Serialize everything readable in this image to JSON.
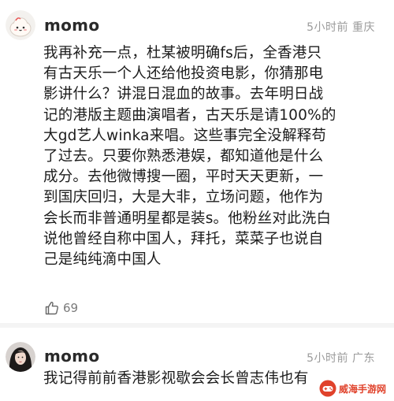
{
  "comments": [
    {
      "username": "momo",
      "meta": "5小时前 重庆",
      "text": "我再补充一点，杜某被明确fs后，全香港只\n有古天乐一个人还给他投资电影，你猜那电\n影讲什么？讲混日混血的故事。去年明日战\n记的港版主题曲演唱者，古天乐是请100%的\n大gd艺人winka来唱。这些事完全没解释苟\n了过去。只要你熟悉港娱，都知道他是什么\n成分。去他微博搜一圈，平时天天更新，一\n到国庆回归，大是大非，立场问题，他作为\n会长而非普通明星都是装s。他粉丝对此洗白\n说他曾经自称中国人，拜托，菜菜子也说自\n己是纯纯滴中国人",
      "likes": "69",
      "like_icon": "thumbs-up-icon",
      "avatar_icon": "cartoon-bun-avatar"
    },
    {
      "username": "momo",
      "meta": "5小时前 广东",
      "text": "我记得前前香港影视歇会会长曾志伟也有",
      "avatar_icon": "dark-hair-portrait-avatar"
    }
  ],
  "watermark": {
    "text": "威海手游网"
  },
  "colors": {
    "meta_gray": "#9b9b9b",
    "divider": "#f4f4f4",
    "watermark_red": "#e0422b"
  }
}
